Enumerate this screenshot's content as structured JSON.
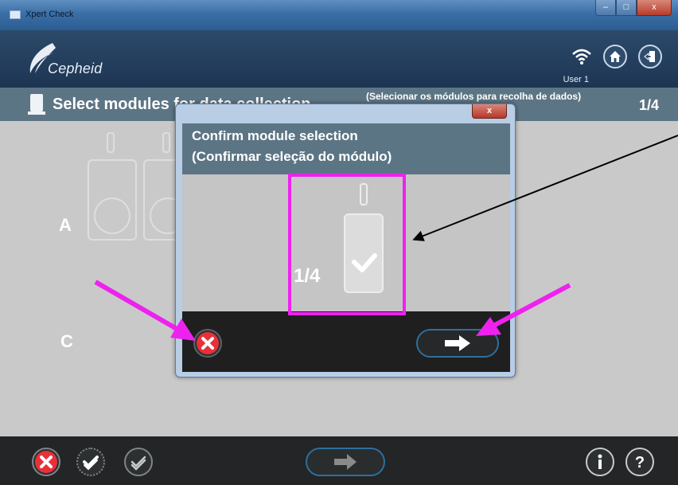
{
  "window": {
    "title": "Xpert Check",
    "controls": [
      "–",
      "□",
      "x"
    ]
  },
  "header": {
    "brand": "Cepheid",
    "user": "User 1",
    "icons": [
      "wifi-icon",
      "home-icon",
      "logout-icon"
    ]
  },
  "subheader": {
    "title": "Select modules for data collection",
    "title_pt": "(Selecionar os módulos para recolha de dados)",
    "counter": "1/4"
  },
  "main": {
    "rows": [
      "A",
      "C"
    ]
  },
  "modal": {
    "close_label": "x",
    "title_en": "Confirm module selection",
    "title_pt": "(Confirmar seleção do módulo)",
    "module_counter": "1/4"
  },
  "bottombar": {
    "icons": [
      "cancel-icon",
      "select-all-icon",
      "deselect-all-icon",
      "next-arrow-icon",
      "info-icon",
      "help-icon"
    ]
  },
  "colors": {
    "accent_magenta": "#ee22ee",
    "cancel_red": "#e8303a",
    "header_navy": "#1d3553",
    "subheader_slate": "#5c7584"
  }
}
